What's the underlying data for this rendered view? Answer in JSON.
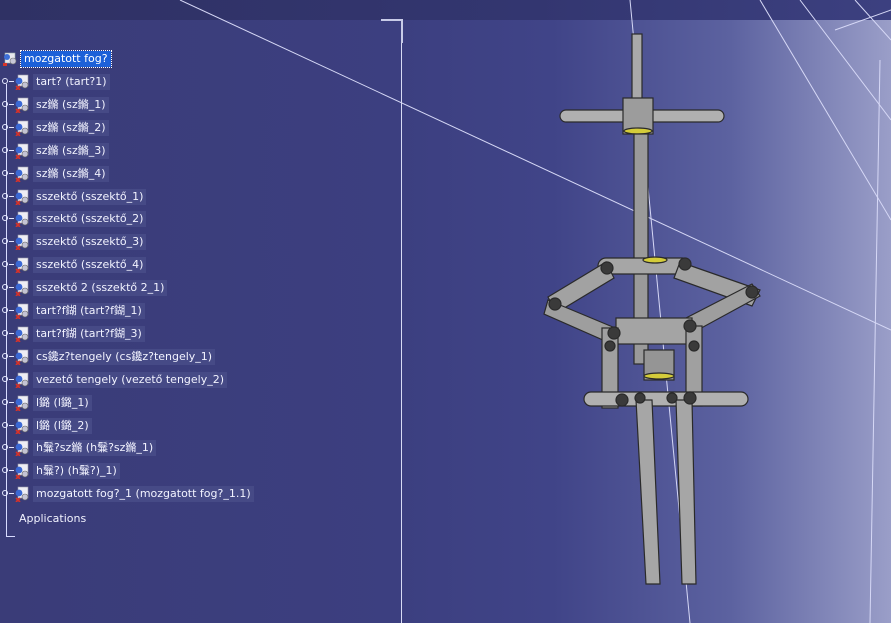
{
  "tree": {
    "root": "mozgatott fog?",
    "items": [
      "tart? (tart?1)",
      "sz鏅 (sz鏅_1)",
      "sz鏅 (sz鏅_2)",
      "sz鏅 (sz鏅_3)",
      "sz鏅 (sz鏅_4)",
      "sszektő (sszektő_1)",
      "sszektő (sszektő_2)",
      "sszektő (sszektő_3)",
      "sszektő (sszektő_4)",
      "sszektő 2 (sszektő 2_1)",
      "tart?f鍸 (tart?f鍸_1)",
      "tart?f鍸 (tart?f鍸_3)",
      "cs鑱z?tengely (cs鑱z?tengely_1)",
      "vezető tengely (vezető tengely_2)",
      "l鏴 (l鏴_1)",
      "l鏴 (l鏴_2)",
      "h鬑?sz鏅 (h鬑?sz鏅_1)",
      "h鬑?) (h鬑?)_1)",
      "mozgatott fog?_1 (mozgatott fog?_1.1)"
    ],
    "applications": "Applications"
  },
  "colors": {
    "background": "#3c3f80",
    "selection": "#1c60d8",
    "part": "#a8a8a8"
  },
  "icons": {
    "root": "product-icon",
    "item": "part-gear-icon"
  }
}
